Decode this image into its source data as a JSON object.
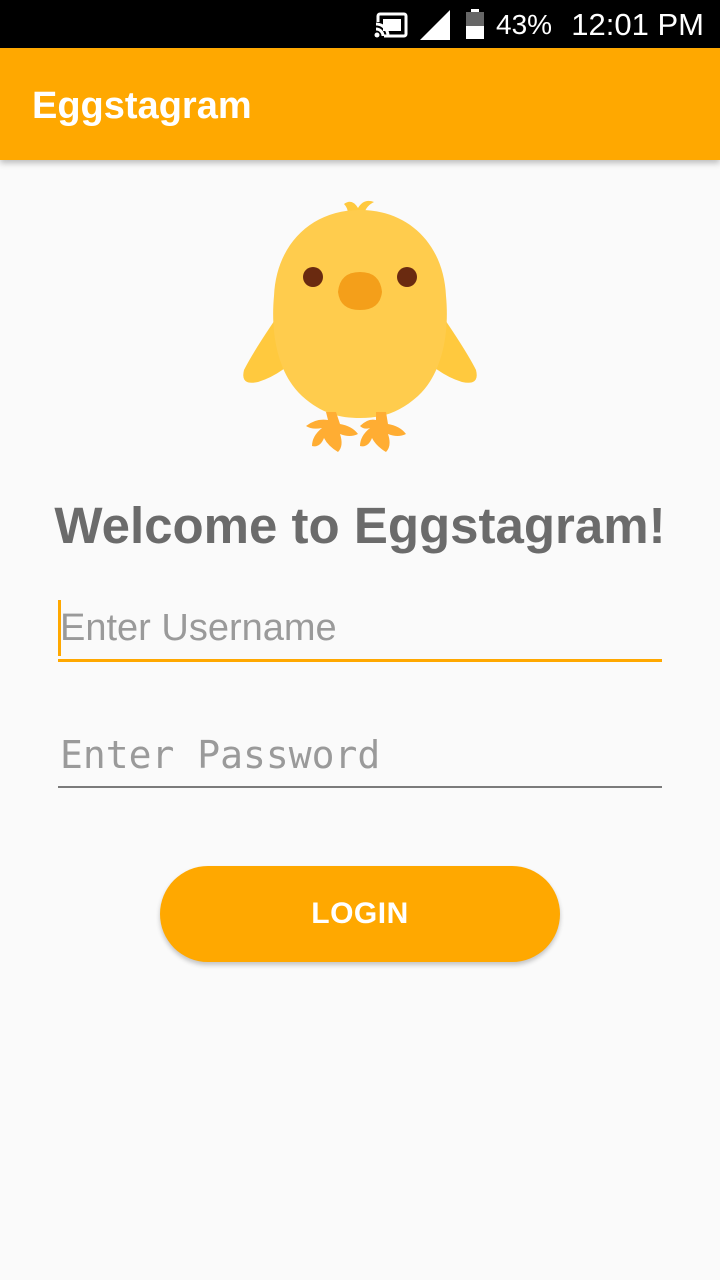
{
  "status_bar": {
    "battery_percent": "43%",
    "time": "12:01 PM",
    "icons": [
      "cast-icon",
      "signal-icon",
      "battery-icon"
    ]
  },
  "app_bar": {
    "title": "Eggstagram"
  },
  "logo": {
    "icon": "chick-icon"
  },
  "welcome_text": "Welcome to Eggstagram!",
  "form": {
    "username_placeholder": "Enter Username",
    "username_value": "",
    "password_placeholder": "Enter Password",
    "password_value": "",
    "login_label": "LOGIN"
  },
  "colors": {
    "accent": "#ffa800",
    "background": "#fafafa",
    "heading": "#6b6b6b"
  }
}
